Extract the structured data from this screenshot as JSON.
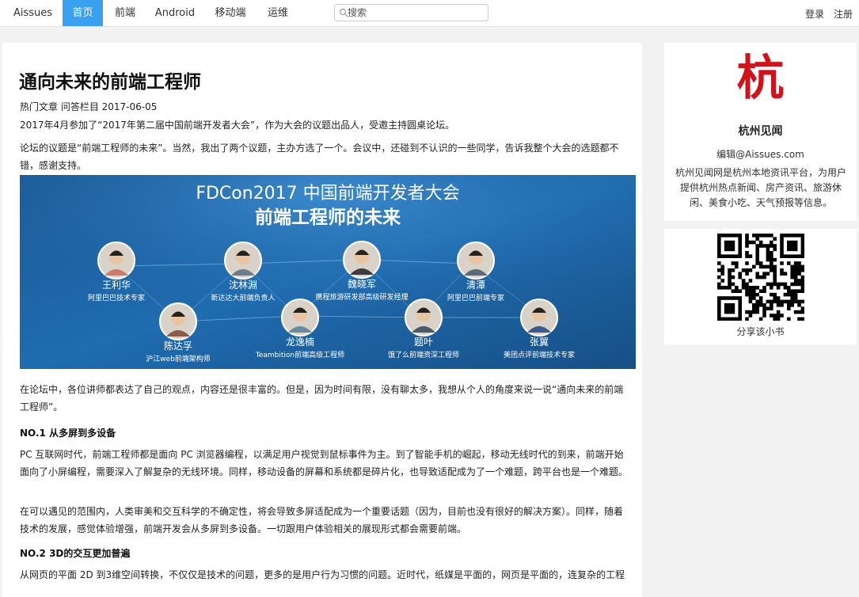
{
  "nav": {
    "brand": "Aissues",
    "items": [
      {
        "label": "首页",
        "active": true
      },
      {
        "label": "前端",
        "active": false
      },
      {
        "label": "Android",
        "active": false
      },
      {
        "label": "移动端",
        "active": false
      },
      {
        "label": "运维",
        "active": false
      }
    ],
    "search_placeholder": "搜索",
    "login": "登录",
    "register": "注册",
    "active_color": "#3aa0f0"
  },
  "article": {
    "title": "通向未来的前端工程师",
    "meta": "热门文章 问答栏目 2017-06-05",
    "p1": "2017年4月参加了“2017年第二届中国前端开发者大会”，作为大会的议题出品人，受邀主持圆桌论坛。",
    "p2": "论坛的议题是“前端工程师的未来”。当然，我出了两个议题，主办方选了一个。会议中，还碰到不认识的一些同学，告诉我整个大会的选题都不错，感谢支持。",
    "banner": {
      "title1": "FDCon2017 中国前端开发者大会",
      "title2": "前端工程师的未来",
      "speakers": [
        {
          "name": "王利华",
          "role": "阿里巴巴技术专家"
        },
        {
          "name": "沈林淵",
          "role": "新达达大前端负责人"
        },
        {
          "name": "魏晓军",
          "role": "携程旅游研发部高级研发经理"
        },
        {
          "name": "清潭",
          "role": "阿里巴巴前端专家"
        },
        {
          "name": "陈达孚",
          "role": "沪江web前端架构师"
        },
        {
          "name": "龙逸楠",
          "role": "Teambition前端高级工程师"
        },
        {
          "name": "题叶",
          "role": "饿了么前端资深工程师"
        },
        {
          "name": "张翼",
          "role": "美团点评前端技术专家"
        }
      ]
    },
    "p3": "在论坛中，各位讲师都表达了自己的观点，内容还是很丰富的。但是，因为时间有限，没有聊太多，我想从个人的角度来说一说“通向未来的前端工程师”。",
    "h1": "NO.1 从多屏到多设备",
    "p4": "PC 互联网时代，前端工程师都是面向 PC 浏览器编程，以满足用户视觉到鼠标事件为主。到了智能手机的崛起，移动无线时代的到来，前端开始面向了小屏编程，需要深入了解复杂的无线环境。同样，移动设备的屏幕和系统都是碎片化，也导致适配成为了一个难题，跨平台也是一个难题。",
    "p5": "在可以遇见的范围内，人类审美和交互科学的不确定性，将会导致多屏适配成为一个重要话题（因为，目前也没有很好的解决方案）。同样，随着技术的发展，感觉体验增强，前端开发会从多屏到多设备。一切跟用户体验相关的展现形式都会需要前端。",
    "h2": "NO.2 3D的交互更加普遍",
    "p6": "从网页的平面 2D 到3维空间转换，不仅仅是技术的问题，更多的是用户行为习惯的问题。近时代，纸媒是平面的，网页是平面的，连复杂的工程"
  },
  "sidebar": {
    "logo_char": "杭",
    "logo_color": "#d0131b",
    "name": "杭州见闻",
    "email": "编辑@Aissues.com",
    "description": "杭州见闻网是杭州本地资讯平台，为用户提供杭州热点新闻、房产资讯、旅游休闲、美食小吃、天气预报等信息。",
    "share_label": "分享该小书"
  }
}
